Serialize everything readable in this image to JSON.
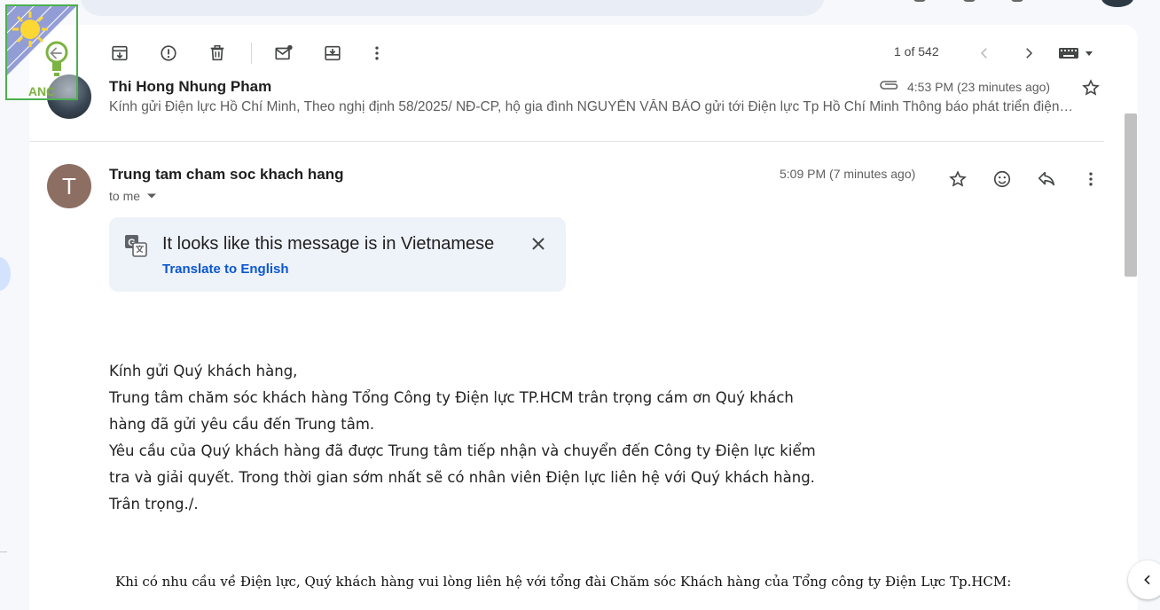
{
  "watermark": {
    "text": "ANC"
  },
  "toolbar": {
    "page_count": "1 of 542",
    "buttons": [
      "back",
      "archive",
      "report-spam",
      "delete",
      "mark-unread",
      "move-to",
      "more"
    ]
  },
  "previous_message": {
    "sender": "Thi Hong Nhung Pham",
    "time": "4:53 PM (23 minutes ago)",
    "snippet": "Kính gửi Điện lực Hồ Chí Minh, Theo nghị định 58/2025/ NĐ-CP, hộ gia đình NGUYỄN VĂN BẢO gửi tới Điện lực Tp Hồ Chí Minh Thông báo phát triển điện…"
  },
  "message": {
    "avatar_letter": "T",
    "sender": "Trung tam cham soc khach hang",
    "to": "to me",
    "time": "5:09 PM (7 minutes ago)",
    "translate": {
      "notice": "It looks like this message is in Vietnamese",
      "link": "Translate to English"
    },
    "body": [
      "Kính gửi Quý khách hàng,",
      "Trung tâm chăm sóc khách hàng Tổng Công ty Điện lực TP.HCM trân trọng cám ơn Quý khách",
      "hàng đã gửi yêu cầu đến Trung tâm.",
      "Yêu cầu của Quý khách hàng đã được Trung tâm tiếp nhận và chuyển đến Công ty Điện lực kiểm",
      "tra và giải quyết. Trong thời gian sớm nhất sẽ có nhân viên Điện lực liên hệ với Quý khách hàng.",
      "Trân trọng./."
    ],
    "footer": "Khi có nhu cầu về Điện lực, Quý khách hàng vui lòng liên hệ với tổng đài Chăm sóc Khách hàng của Tổng công ty Điện Lực Tp.HCM:"
  },
  "colors": {
    "accent": "#0b57d0",
    "avatar": "#8d6e63",
    "translate_bg": "#eef2f9"
  }
}
